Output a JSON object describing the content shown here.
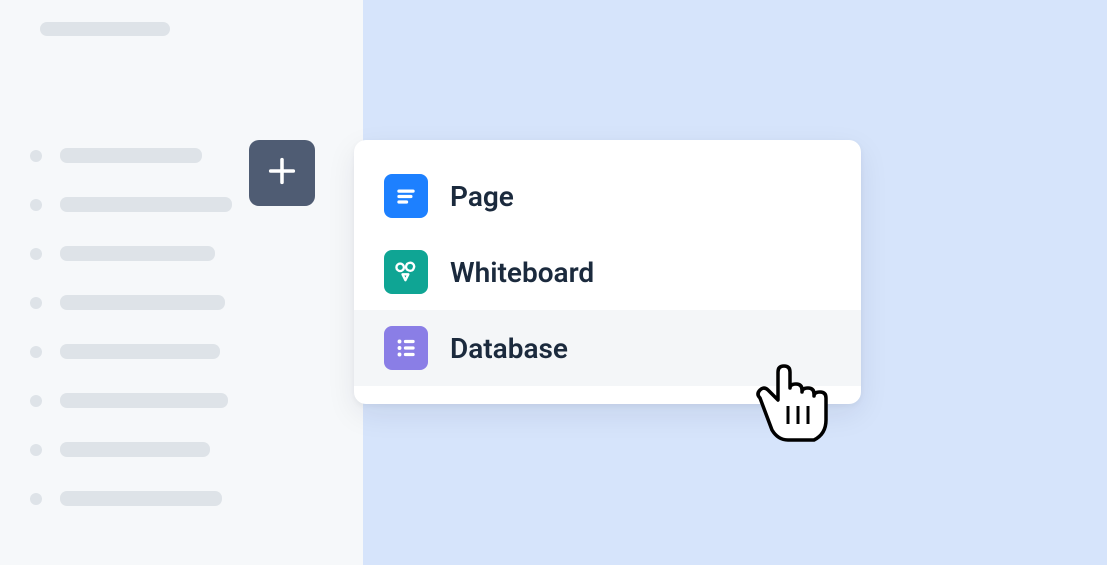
{
  "menu": {
    "items": [
      {
        "label": "Page",
        "icon": "page",
        "hovered": false
      },
      {
        "label": "Whiteboard",
        "icon": "whiteboard",
        "hovered": false
      },
      {
        "label": "Database",
        "icon": "database",
        "hovered": true
      }
    ]
  },
  "colors": {
    "accent_blue": "#1d80ff",
    "accent_teal": "#0fa594",
    "accent_purple": "#8a7ee6",
    "add_button": "#4f5c73",
    "placeholder": "#dee3e8",
    "main_bg": "#d6e4fb"
  }
}
